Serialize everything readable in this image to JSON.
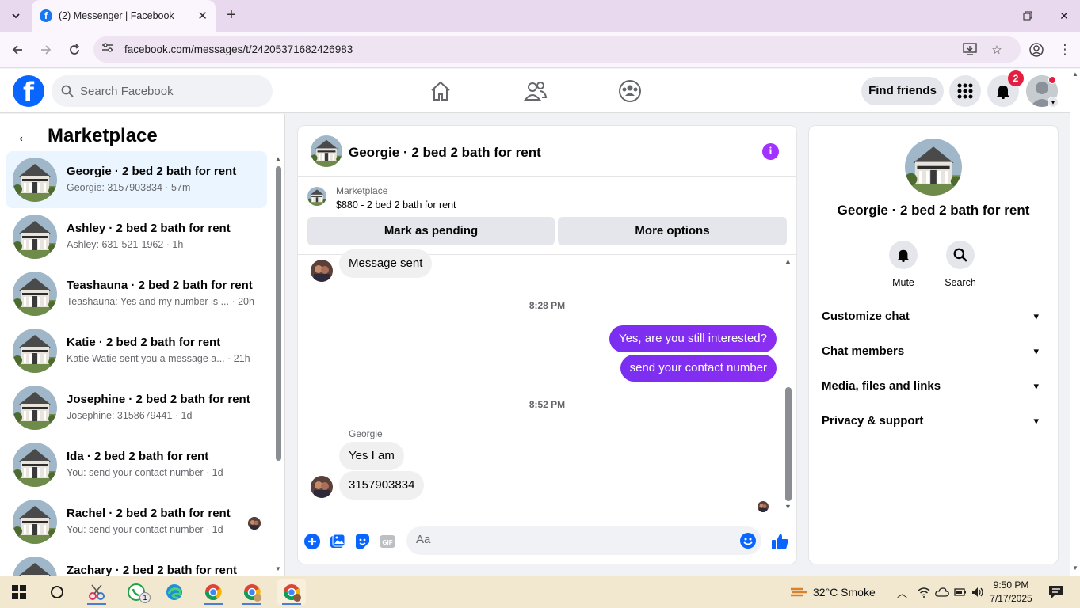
{
  "browser": {
    "tab_title": "(2) Messenger | Facebook",
    "url": "facebook.com/messages/t/24205371682426983"
  },
  "fb": {
    "search_placeholder": "Search Facebook",
    "find_friends": "Find friends",
    "notification_count": "2"
  },
  "sidebar": {
    "title": "Marketplace",
    "conversations": [
      {
        "name": "Georgie · 2 bed 2 bath for rent",
        "preview": "Georgie: 3157903834 · 57m",
        "active": true
      },
      {
        "name": "Ashley · 2 bed 2 bath for rent",
        "preview": "Ashley: 631-521-1962 · 1h"
      },
      {
        "name": "Teashauna · 2 bed 2 bath for rent",
        "preview": "Teashauna: Yes and my number is ... · 20h"
      },
      {
        "name": "Katie · 2 bed 2 bath for rent",
        "preview": "Katie Watie sent you a message a...  · 21h"
      },
      {
        "name": "Josephine · 2 bed 2 bath for rent",
        "preview": "Josephine: 3158679441 · 1d"
      },
      {
        "name": "Ida · 2 bed 2 bath for rent",
        "preview": "You: send your contact number · 1d"
      },
      {
        "name": "Rachel · 2 bed 2 bath for rent",
        "preview": "You: send your contact number · 1d"
      },
      {
        "name": "Zachary · 2 bed 2 bath for rent",
        "preview": ""
      }
    ]
  },
  "chat": {
    "title": "Georgie · 2 bed 2 bath for rent",
    "marketplace_label": "Marketplace",
    "listing": "$880 - 2 bed 2 bath for rent",
    "mark_pending": "Mark as pending",
    "more_options": "More options",
    "messages": {
      "m1": "Message sent",
      "ts1": "8:28 PM",
      "out1": "Yes, are you still interested?",
      "out2": "send your contact number",
      "ts2": "8:52 PM",
      "sender": "Georgie",
      "in1": "Yes I am",
      "in2": "3157903834"
    },
    "composer_placeholder": "Aa"
  },
  "info": {
    "name": "Georgie · 2 bed 2 bath for rent",
    "mute": "Mute",
    "search": "Search",
    "sections": [
      "Customize chat",
      "Chat members",
      "Media, files and links",
      "Privacy & support"
    ]
  },
  "taskbar": {
    "weather": "32°C  Smoke",
    "time": "9:50 PM",
    "date": "7/17/2025",
    "whatsapp_badge": "1"
  },
  "colors": {
    "fb_blue": "#0866ff",
    "messenger_purple": "#8b2ef2",
    "active_row": "#ebf5ff",
    "notification_red": "#e41e3f"
  }
}
